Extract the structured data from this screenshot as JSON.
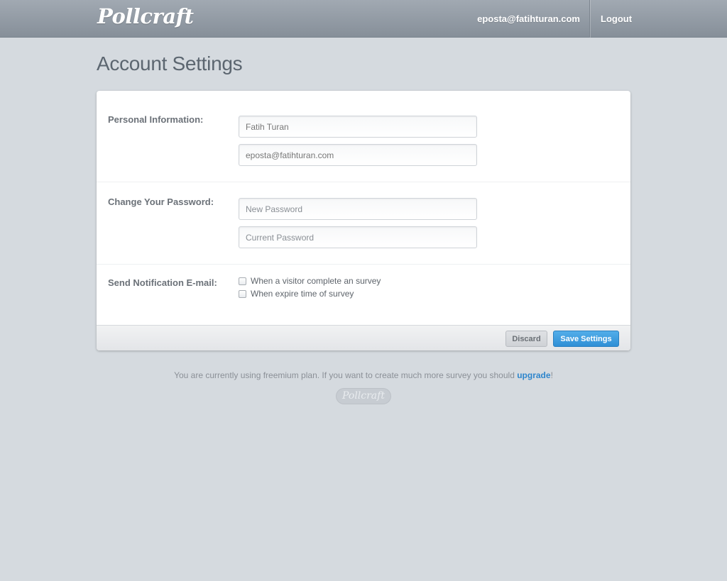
{
  "header": {
    "logo_text": "Pollcraft",
    "user_email": "eposta@fatihturan.com",
    "logout_label": "Logout"
  },
  "page": {
    "title": "Account Settings"
  },
  "form": {
    "personal": {
      "label": "Personal Information:",
      "name_value": "Fatih Turan",
      "email_value": "eposta@fatihturan.com"
    },
    "password": {
      "label": "Change Your Password:",
      "new_placeholder": "New Password",
      "current_placeholder": "Current Password"
    },
    "notifications": {
      "label": "Send Notification E-mail:",
      "options": [
        {
          "label": "When a visitor complete an survey",
          "checked": false
        },
        {
          "label": "When expire time of survey",
          "checked": false
        }
      ]
    },
    "actions": {
      "discard_label": "Discard",
      "save_label": "Save Settings"
    }
  },
  "footer": {
    "notice_text": "You are currently using freemium plan. If you want to create much more survey you should ",
    "upgrade_label": "upgrade",
    "notice_end": "!",
    "badge_text": "Pollcraft"
  },
  "colors": {
    "background": "#d5dadf",
    "accent": "#2f8fd6",
    "link": "#2f86cc"
  }
}
